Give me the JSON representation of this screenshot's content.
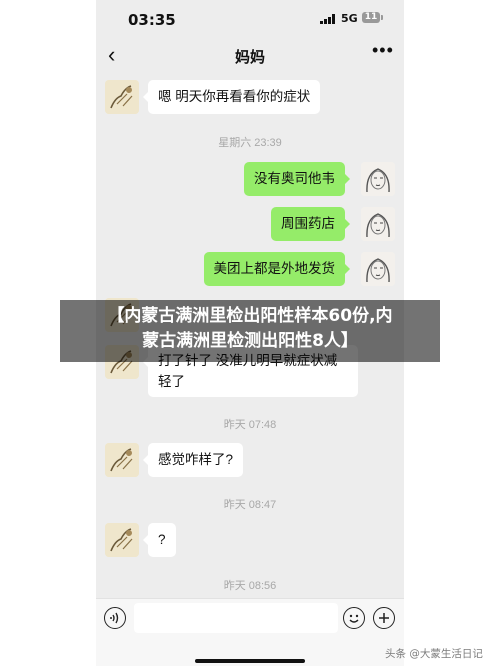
{
  "status_bar": {
    "time": "03:35",
    "network": "5G",
    "battery": "11"
  },
  "header": {
    "back": "‹",
    "title": "妈妈",
    "more": "•••"
  },
  "messages": [
    {
      "side": "left",
      "text": "嗯 明天你再看看你的症状"
    },
    {
      "timestamp": "星期六 23:39"
    },
    {
      "side": "right",
      "text": "没有奥司他韦"
    },
    {
      "side": "right",
      "text": "周围药店"
    },
    {
      "side": "right",
      "text": "美团上都是外地发货"
    },
    {
      "side": "left",
      "text": "打了针了 没准儿明早就症状减轻了"
    },
    {
      "timestamp": "昨天 07:48"
    },
    {
      "side": "left",
      "text": "感觉咋样了?"
    },
    {
      "timestamp": "昨天 08:47"
    },
    {
      "side": "left",
      "text": "?"
    },
    {
      "timestamp": "昨天 08:56"
    }
  ],
  "overlay": {
    "line1": "【内蒙古满洲里检出阳性样本60份,内",
    "line2": "蒙古满洲里检测出阳性8人】"
  },
  "watermark": "头条 @大蒙生活日记"
}
